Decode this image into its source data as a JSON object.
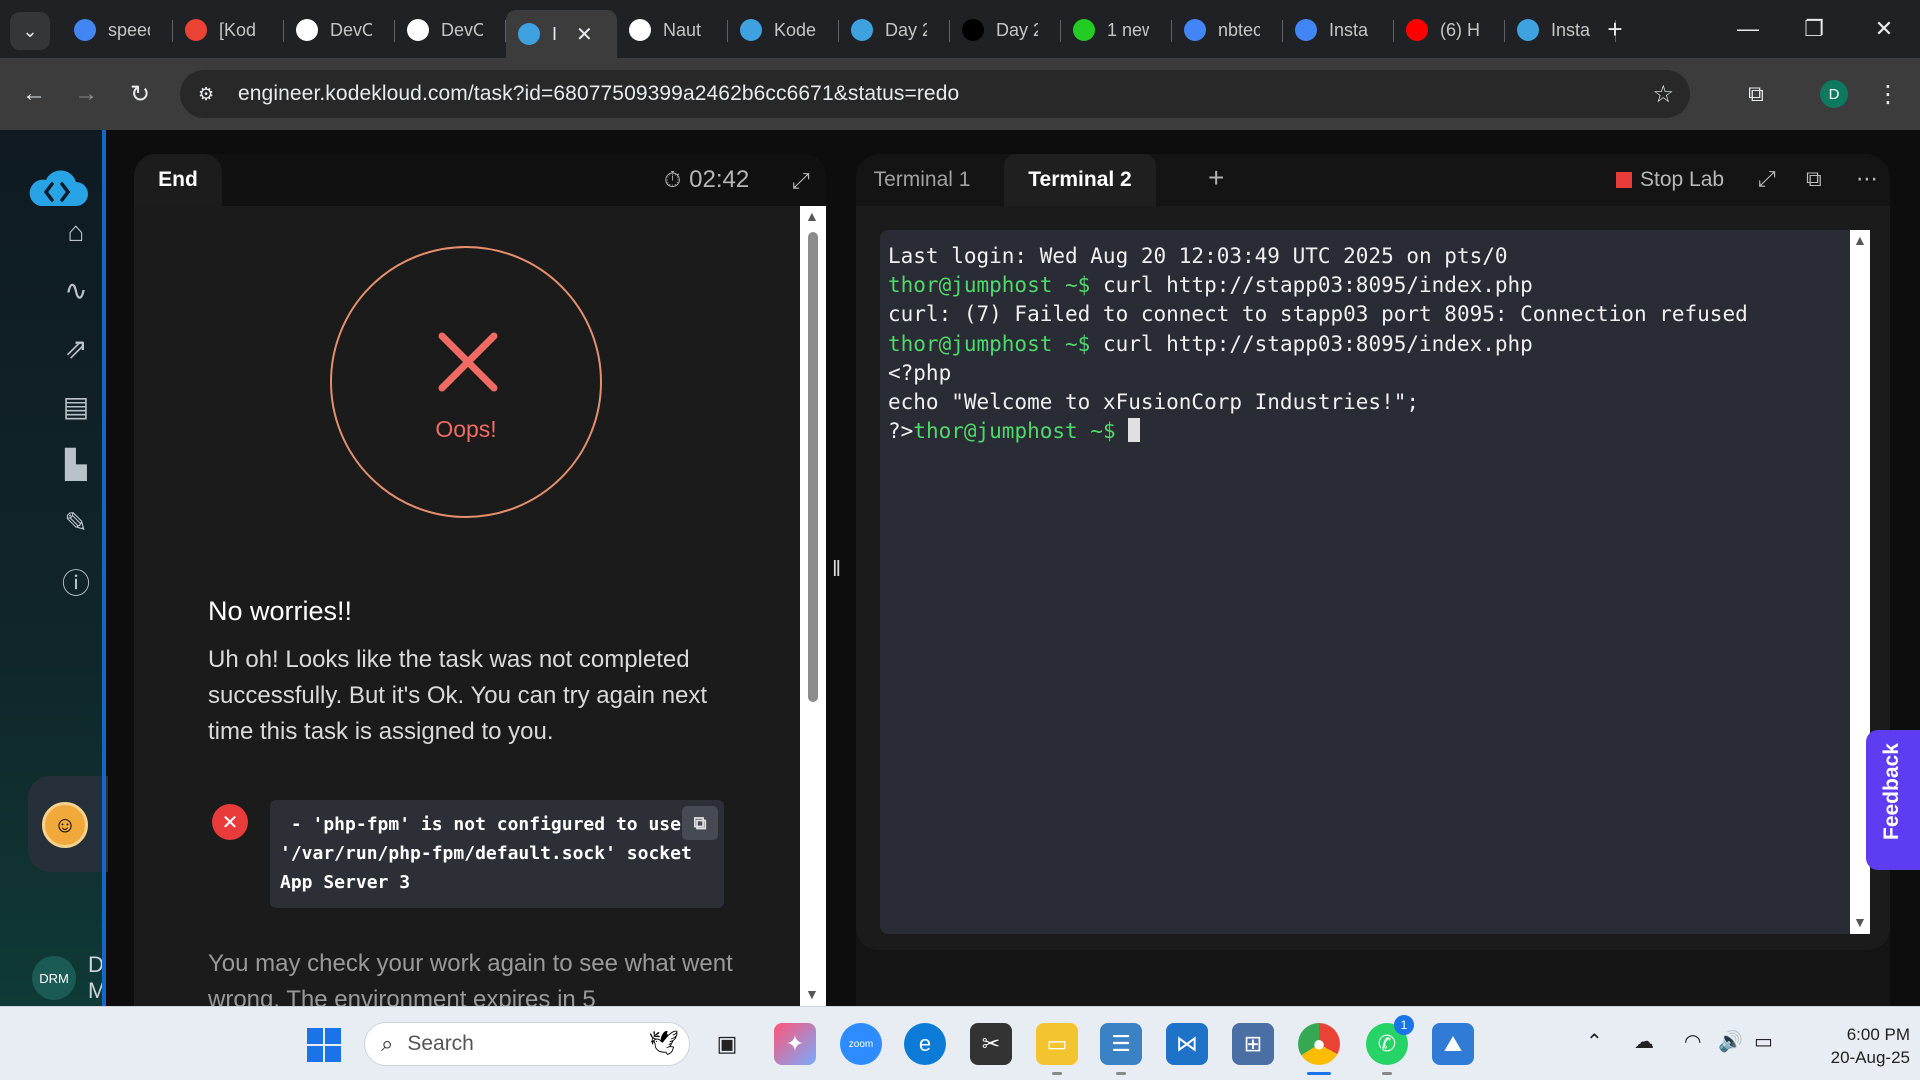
{
  "browser": {
    "tabs": [
      {
        "label": "speed",
        "icon": "google-icon",
        "color": "#4285f4"
      },
      {
        "label": "[Kod",
        "icon": "gmail-icon",
        "color": "#ea4335"
      },
      {
        "label": "DevO",
        "icon": "github-icon",
        "color": "#ffffff"
      },
      {
        "label": "DevO",
        "icon": "github-icon",
        "color": "#ffffff"
      },
      {
        "label": "I",
        "icon": "kodekloud-icon",
        "color": "#3ea2e0",
        "active": true
      },
      {
        "label": "Naut",
        "icon": "doc-icon",
        "color": "#ffffff"
      },
      {
        "label": "Kode",
        "icon": "kodekloud-icon",
        "color": "#3ea2e0"
      },
      {
        "label": "Day 2",
        "icon": "kodekloud-icon",
        "color": "#3ea2e0"
      },
      {
        "label": "Day 2",
        "icon": "medium-icon",
        "color": "#000000"
      },
      {
        "label": "1 new",
        "icon": "green-app-icon",
        "color": "#22cc22"
      },
      {
        "label": "nbtec",
        "icon": "google-icon",
        "color": "#4285f4"
      },
      {
        "label": "Insta",
        "icon": "google-icon",
        "color": "#4285f4"
      },
      {
        "label": "(6) H",
        "icon": "youtube-icon",
        "color": "#ff0000"
      },
      {
        "label": "Insta",
        "icon": "kodekloud-icon",
        "color": "#3ea2e0"
      }
    ],
    "url": "engineer.kodekloud.com/task?id=68077509399a2462b6cc6671&status=redo",
    "profile_initial": "D"
  },
  "sidebar": {
    "icons": [
      "home-icon",
      "roadmap-icon",
      "progress-icon",
      "labs-icon",
      "leaderboard-icon",
      "tasks-icon",
      "info-icon"
    ],
    "user_badge": "DRM",
    "user_name_partial": "D M"
  },
  "task": {
    "tab_label": "End",
    "timer": "02:42",
    "oops": "Oops!",
    "heading": "No worries!!",
    "message": "Uh oh! Looks like the task was not completed successfully. But it's Ok. You can try again next time this task is assigned to you.",
    "error_lines": [
      " - 'php-fpm' is not configured to use",
      "'/var/run/php-fpm/default.sock' socket",
      "App Server 3"
    ],
    "check_text": "You may check your work again to see what went wrong. The environment expires in 5"
  },
  "terminal": {
    "tabs": [
      "Terminal 1",
      "Terminal 2"
    ],
    "active_tab": "Terminal 2",
    "stop_lab": "Stop Lab",
    "lines": [
      {
        "text": "Last login: Wed Aug 20 12:03:49 UTC 2025 on pts/0"
      },
      {
        "prompt": "thor@jumphost ~$",
        "text": " curl http://stapp03:8095/index.php"
      },
      {
        "text": "curl: (7) Failed to connect to stapp03 port 8095: Connection refused"
      },
      {
        "prompt": "thor@jumphost ~$",
        "text": " curl http://stapp03:8095/index.php"
      },
      {
        "text": "<?php"
      },
      {
        "text": "echo \"Welcome to xFusionCorp Industries!\";"
      },
      {
        "pre": "?>",
        "prompt": "thor@jumphost ~$",
        "text": " ",
        "cursor": true
      }
    ],
    "feedback_label": "Feedback"
  },
  "taskbar": {
    "search_placeholder": "Search",
    "clock_time": "6:00 PM",
    "clock_date": "20-Aug-25",
    "whatsapp_badge": "1"
  }
}
